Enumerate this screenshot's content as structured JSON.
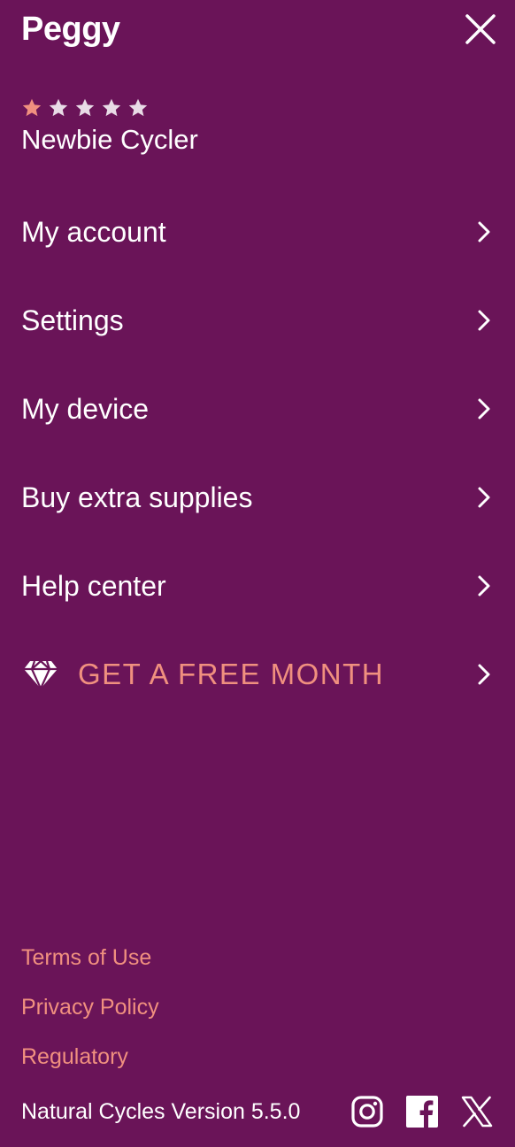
{
  "header": {
    "user_name": "Peggy",
    "close_icon": "close-icon"
  },
  "rank": {
    "stars_total": 5,
    "stars_filled": 1,
    "star_filled_color": "#f0907f",
    "star_empty_color": "#e8dbe6",
    "title": "Newbie Cycler"
  },
  "menu": {
    "items": [
      {
        "label": "My account",
        "icon": "chevron-right-icon"
      },
      {
        "label": "Settings",
        "icon": "chevron-right-icon"
      },
      {
        "label": "My device",
        "icon": "chevron-right-icon"
      },
      {
        "label": "Buy extra supplies",
        "icon": "chevron-right-icon"
      },
      {
        "label": "Help center",
        "icon": "chevron-right-icon"
      }
    ],
    "promo": {
      "label": "GET A FREE MONTH",
      "leading_icon": "diamond-icon",
      "icon": "chevron-right-icon",
      "color": "#f0907f"
    }
  },
  "footer": {
    "links": [
      "Terms of Use",
      "Privacy Policy",
      "Regulatory"
    ],
    "version": "Natural Cycles Version 5.5.0",
    "social": [
      "instagram-icon",
      "facebook-icon",
      "x-icon"
    ]
  },
  "colors": {
    "background": "#6a1458",
    "accent": "#f0907f",
    "text": "#ffffff"
  }
}
